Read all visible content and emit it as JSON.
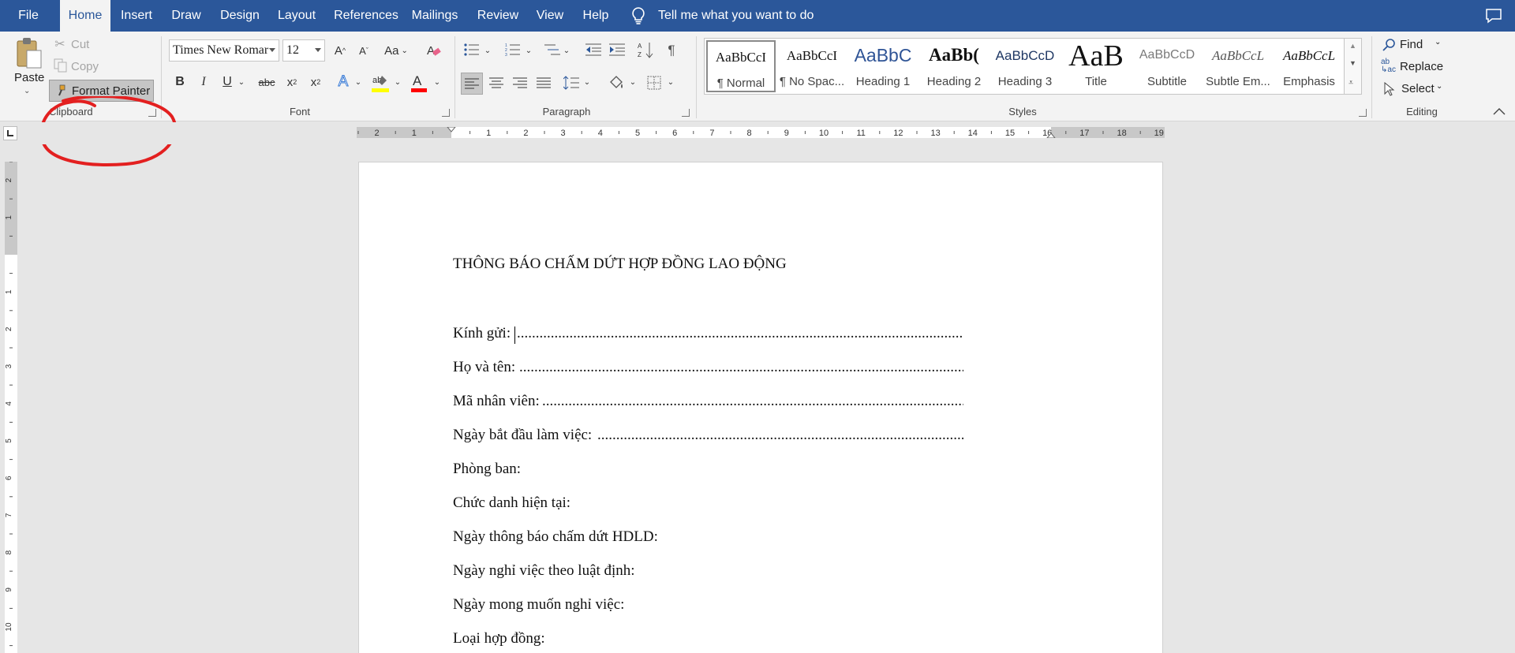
{
  "menu": {
    "tabs": [
      "File",
      "Home",
      "Insert",
      "Draw",
      "Design",
      "Layout",
      "References",
      "Mailings",
      "Review",
      "View",
      "Help"
    ],
    "active_tab": "Home",
    "tell_me": "Tell me what you want to do"
  },
  "ribbon": {
    "clipboard": {
      "paste": "Paste",
      "cut": "Cut",
      "copy": "Copy",
      "format_painter": "Format Painter",
      "label": "Clipboard"
    },
    "font": {
      "font_name": "Times New Roman",
      "font_name_display": "Times New Romar",
      "font_size": "12",
      "label": "Font",
      "change_case": "Aa",
      "highlight_color": "#ffff00",
      "font_color": "#ff0000"
    },
    "paragraph": {
      "label": "Paragraph"
    },
    "styles": {
      "label": "Styles",
      "items": [
        {
          "sample": "AaBbCcI",
          "name": "¶ Normal"
        },
        {
          "sample": "AaBbCcI",
          "name": "¶ No Spac..."
        },
        {
          "sample": "AaBbC",
          "name": "Heading 1"
        },
        {
          "sample": "AaBb(",
          "name": "Heading 2"
        },
        {
          "sample": "AaBbCcD",
          "name": "Heading 3"
        },
        {
          "sample": "AaB",
          "name": "Title"
        },
        {
          "sample": "AaBbCcD",
          "name": "Subtitle"
        },
        {
          "sample": "AaBbCcL",
          "name": "Subtle Em..."
        },
        {
          "sample": "AaBbCcL",
          "name": "Emphasis"
        }
      ]
    },
    "editing": {
      "find": "Find",
      "replace": "Replace",
      "select": "Select",
      "label": "Editing"
    }
  },
  "ruler": {
    "left_numbers": [
      "2",
      "1"
    ],
    "right_numbers": [
      "1",
      "2",
      "3",
      "4",
      "5",
      "6",
      "7",
      "8",
      "9",
      "10",
      "11",
      "12",
      "13",
      "14",
      "15",
      "16",
      "17",
      "18",
      "19"
    ],
    "vertical_numbers": [
      "2",
      "1",
      "1",
      "2",
      "3",
      "4",
      "5",
      "6",
      "7",
      "8",
      "9",
      "10"
    ]
  },
  "document": {
    "title": "THÔNG BÁO CHẤM DỨT HỢP ĐỒNG LAO ĐỘNG",
    "fields": [
      "Kính gửi:",
      "Họ và tên:",
      "Mã nhân viên:",
      "Ngày bắt đầu làm việc:",
      "Phòng ban:",
      "Chức danh hiện tại:",
      "Ngày thông báo chấm dứt HDLD:",
      "Ngày nghỉ việc theo luật định:",
      "Ngày mong muốn nghỉ việc:",
      "Loại hợp đồng:"
    ],
    "dot_leader": "......................................................................................................................................................................................."
  },
  "colors": {
    "brand": "#2b579a",
    "annotation": "#e32020"
  }
}
